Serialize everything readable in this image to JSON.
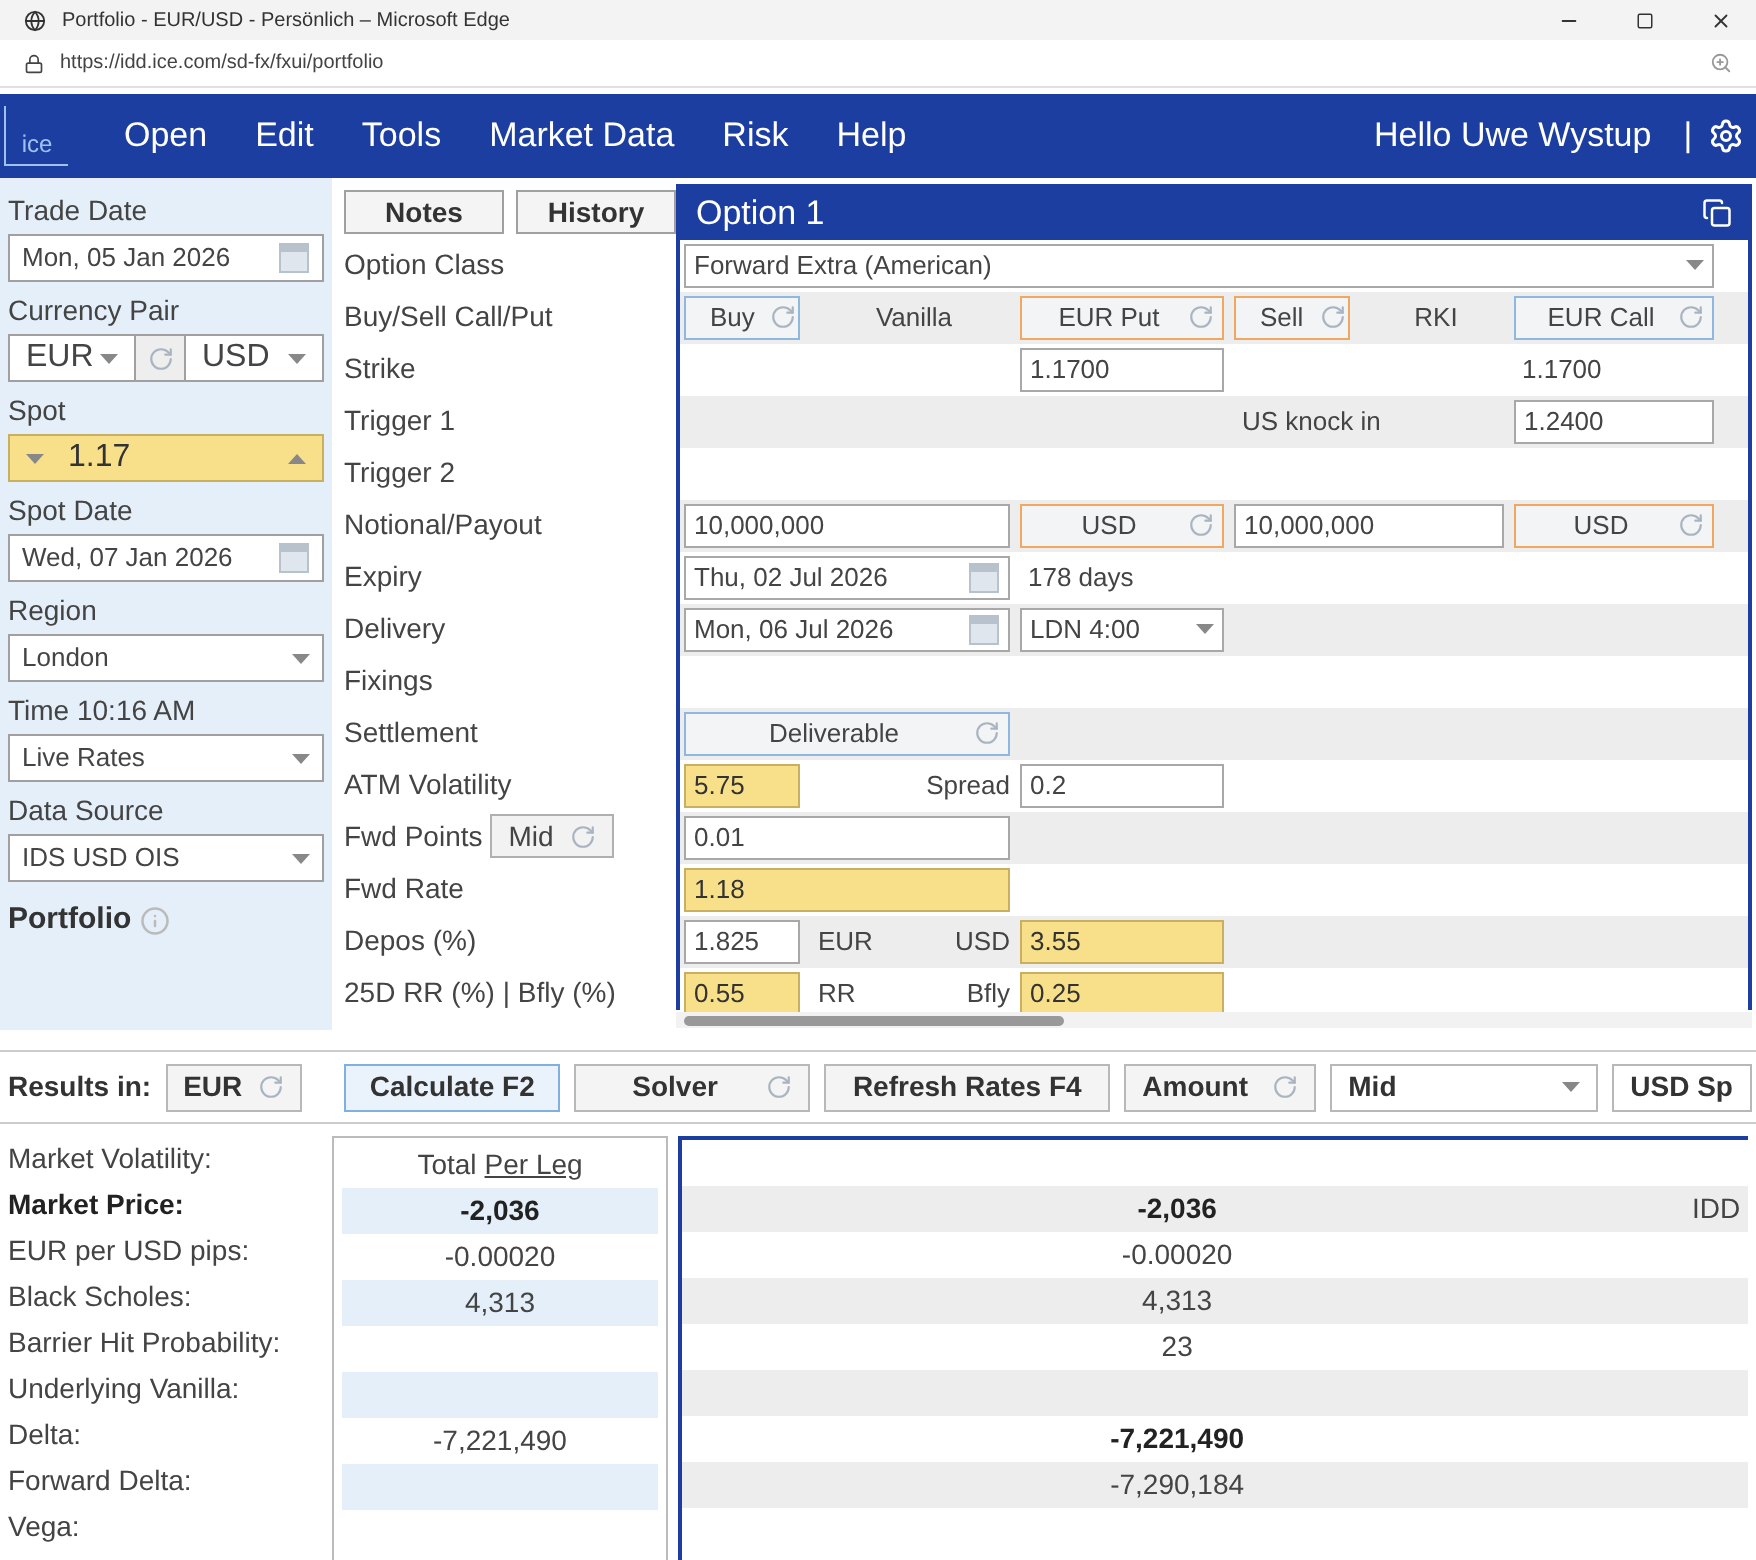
{
  "browser": {
    "title": "Portfolio - EUR/USD - Persönlich – Microsoft Edge",
    "url": "https://idd.ice.com/sd-fx/fxui/portfolio"
  },
  "nav": {
    "logo": "ice",
    "items": [
      "Open",
      "Edit",
      "Tools",
      "Market Data",
      "Risk",
      "Help"
    ],
    "greeting": "Hello Uwe Wystup",
    "separator": "|"
  },
  "sidebar": {
    "fields": [
      {
        "label": "Trade Date",
        "kind": "date",
        "value": "Mon, 05 Jan 2026"
      },
      {
        "label": "Currency Pair",
        "kind": "pair",
        "base": "EUR",
        "quote": "USD"
      },
      {
        "label": "Spot",
        "kind": "spinner",
        "value": "1.17"
      },
      {
        "label": "Spot Date",
        "kind": "date",
        "value": "Wed, 07 Jan 2026"
      },
      {
        "label": "Region",
        "kind": "select",
        "value": "London"
      },
      {
        "label": "Time 10:16 AM",
        "kind": "select",
        "value": "Live Rates"
      },
      {
        "label": "Data Source",
        "kind": "select",
        "value": "IDS USD OIS"
      }
    ],
    "portfolio": "Portfolio"
  },
  "field_labels": {
    "buttons": [
      "Notes",
      "History"
    ],
    "rows": [
      {
        "label": "Option Class"
      },
      {
        "label": "Buy/Sell Call/Put"
      },
      {
        "label": "Strike"
      },
      {
        "label": "Trigger 1"
      },
      {
        "label": "Trigger 2"
      },
      {
        "label": "Notional/Payout"
      },
      {
        "label": "Expiry"
      },
      {
        "label": "Delivery"
      },
      {
        "label": "Fixings"
      },
      {
        "label": "Settlement"
      },
      {
        "label": "ATM Volatility"
      },
      {
        "label": "Fwd Points",
        "toggle": "Mid"
      },
      {
        "label": "Fwd Rate"
      },
      {
        "label": "Depos (%)"
      },
      {
        "label": "25D RR (%) | Bfly (%)"
      }
    ]
  },
  "option": {
    "title": "Option 1",
    "rows": [
      [
        {
          "kind": "select",
          "value": "Forward Extra (American)"
        }
      ],
      [
        {
          "kind": "parts",
          "parts": [
            {
              "kind": "toggle",
              "text": "Buy",
              "color": "#8fb8e0"
            },
            {
              "kind": "text",
              "text": "Vanilla"
            }
          ]
        },
        {
          "kind": "toggle",
          "text": "EUR Put",
          "color": "#f0a860"
        },
        {
          "kind": "parts",
          "parts": [
            {
              "kind": "toggle",
              "text": "Sell",
              "color": "#f0a860"
            },
            {
              "kind": "text",
              "text": "RKI"
            }
          ]
        },
        {
          "kind": "toggle",
          "text": "EUR Call",
          "color": "#8fb8e0"
        }
      ],
      [
        null,
        {
          "kind": "input",
          "value": "1.1700",
          "highlighted": false
        },
        null,
        {
          "kind": "text",
          "text": "1.1700"
        }
      ],
      [
        null,
        null,
        {
          "kind": "text",
          "text": "US knock in"
        },
        {
          "kind": "input",
          "value": "1.2400",
          "highlighted": false
        }
      ],
      [
        null,
        null,
        null,
        null
      ],
      [
        {
          "kind": "input",
          "value": "10,000,000",
          "highlighted": false
        },
        {
          "kind": "toggle",
          "text": "USD",
          "color": "#f0a860"
        },
        {
          "kind": "input",
          "value": "10,000,000",
          "highlighted": false
        },
        {
          "kind": "toggle",
          "text": "USD",
          "color": "#f0a860"
        }
      ],
      [
        {
          "kind": "date",
          "value": "Thu, 02 Jul 2026"
        },
        {
          "kind": "text",
          "text": "178 days"
        },
        null,
        null
      ],
      [
        {
          "kind": "date",
          "value": "Mon, 06 Jul 2026"
        },
        {
          "kind": "select",
          "value": "LDN 4:00"
        },
        null,
        null
      ],
      [
        null,
        null,
        null,
        null
      ],
      [
        {
          "kind": "toggle",
          "text": "Deliverable",
          "color": "#8fb8e0"
        },
        null,
        null,
        null
      ],
      [
        {
          "kind": "parts",
          "parts": [
            {
              "kind": "input",
              "value": "5.75",
              "highlighted": true
            },
            {
              "kind": "text",
              "text": "Spread"
            }
          ]
        },
        {
          "kind": "input",
          "value": "0.2",
          "highlighted": false
        },
        null,
        null
      ],
      [
        {
          "kind": "input",
          "value": "0.01",
          "highlighted": false
        },
        null,
        null,
        null
      ],
      [
        {
          "kind": "input",
          "value": "1.18",
          "highlighted": true
        },
        null,
        null,
        null
      ],
      [
        {
          "kind": "parts",
          "parts": [
            {
              "kind": "input",
              "value": "1.825",
              "highlighted": false
            },
            {
              "kind": "text",
              "text": "EUR"
            },
            {
              "kind": "text",
              "text": "USD"
            }
          ]
        },
        {
          "kind": "input",
          "value": "3.55",
          "highlighted": true
        },
        null,
        null
      ],
      [
        {
          "kind": "parts",
          "parts": [
            {
              "kind": "input",
              "value": "0.55",
              "highlighted": true
            },
            {
              "kind": "text",
              "text": "RR"
            },
            {
              "kind": "text",
              "text": "Bfly"
            }
          ]
        },
        {
          "kind": "input",
          "value": "0.25",
          "highlighted": true
        },
        null,
        null
      ]
    ]
  },
  "results_toolbar": {
    "label": "Results in:",
    "currency": "EUR",
    "buttons": [
      {
        "kind": "primary",
        "text": "Calculate F2"
      },
      {
        "kind": "toggle",
        "text": "Solver"
      },
      {
        "kind": "plain",
        "text": "Refresh Rates F4"
      },
      {
        "kind": "toggle",
        "text": "Amount"
      },
      {
        "kind": "select",
        "text": "Mid"
      },
      {
        "kind": "cut",
        "text": "USD Sp"
      }
    ]
  },
  "results": {
    "header_total": "Total",
    "header_per_leg": "Per Leg",
    "rows": [
      {
        "label": "Market Volatility:",
        "bold": false
      },
      {
        "label": "Market Price:",
        "bold": true,
        "total": "-2,036",
        "total_bold": true,
        "leg": "-2,036",
        "leg_bold": true,
        "column_3": "IDD"
      },
      {
        "label": "EUR per USD pips:",
        "bold": false,
        "total": "-0.00020",
        "total_bold": false,
        "leg": "-0.00020",
        "leg_bold": false
      },
      {
        "label": "Black Scholes:",
        "bold": false,
        "total": "4,313",
        "total_bold": false,
        "leg": "4,313",
        "leg_bold": false
      },
      {
        "label": "Barrier Hit Probability:",
        "bold": false,
        "leg": "23",
        "leg_bold": false
      },
      {
        "label": "Underlying Vanilla:",
        "bold": false
      },
      {
        "label": "Delta:",
        "bold": false,
        "total": "-7,221,490",
        "total_bold": false,
        "leg": "-7,221,490",
        "leg_bold": true
      },
      {
        "label": "Forward Delta:",
        "bold": false,
        "leg": "-7,290,184",
        "leg_bold": false
      },
      {
        "label": "Vega:",
        "bold": false
      }
    ]
  }
}
